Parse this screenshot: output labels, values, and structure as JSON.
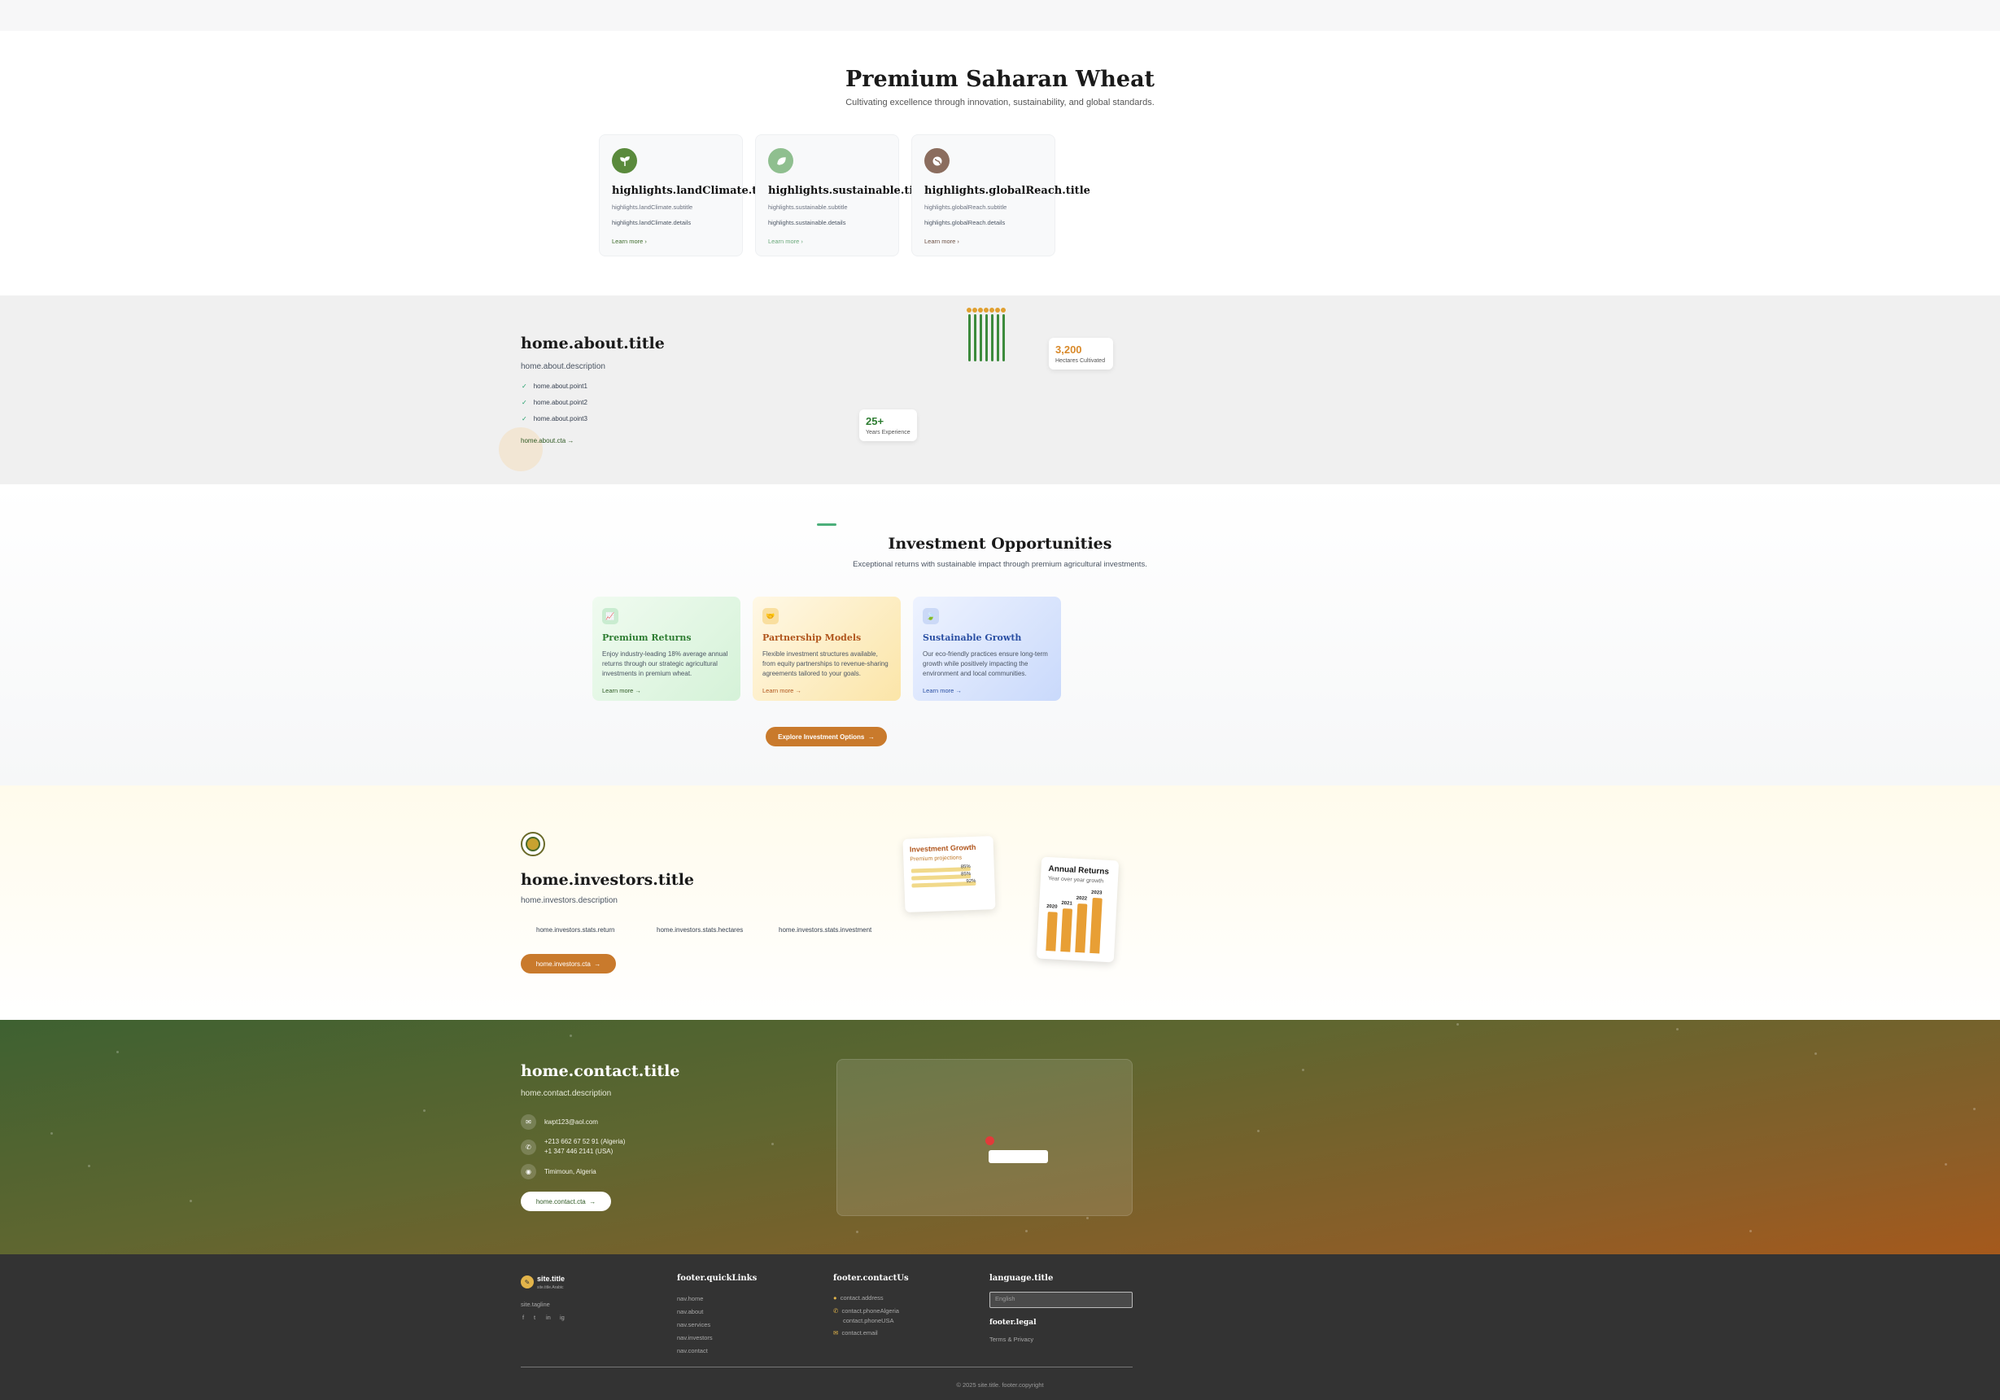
{
  "highlights": {
    "title": "Premium Saharan Wheat",
    "subtitle": "Cultivating excellence through innovation, sustainability, and global standards.",
    "cards": [
      {
        "icon": "sprout-icon",
        "color": "#5a8a3c",
        "title": "highlights.landClimate.title",
        "subtitle": "highlights.landClimate.subtitle",
        "details": "highlights.landClimate.details",
        "link": "Learn more ›",
        "link_color": "#3d6b2a"
      },
      {
        "icon": "leaf-icon",
        "color": "#8fbf8f",
        "title": "highlights.sustainable.title",
        "subtitle": "highlights.sustainable.subtitle",
        "details": "highlights.sustainable.details",
        "link": "Learn more ›",
        "link_color": "#6aa97a"
      },
      {
        "icon": "globe-icon",
        "color": "#8b6d5e",
        "title": "highlights.globalReach.title",
        "subtitle": "highlights.globalReach.subtitle",
        "details": "highlights.globalReach.details",
        "link": "Learn more ›",
        "link_color": "#6b4f43"
      }
    ]
  },
  "about": {
    "title": "home.about.title",
    "description": "home.about.description",
    "points": [
      "home.about.point1",
      "home.about.point2",
      "home.about.point3"
    ],
    "cta": "home.about.cta",
    "stats": [
      {
        "value": "3,200",
        "label": "Hectares Cultivated",
        "color": "#d98a2b"
      },
      {
        "value": "25+",
        "label": "Years Experience",
        "color": "#2e7d32"
      }
    ]
  },
  "investment": {
    "title": "Investment Opportunities",
    "subtitle": "Exceptional returns with sustainable impact through premium agricultural investments.",
    "cards": [
      {
        "icon": "chart-icon",
        "title": "Premium Returns",
        "description": "Enjoy industry-leading 18% average annual returns through our strategic agricultural investments in premium wheat.",
        "link": "Learn more →",
        "title_color": "#2e7d32",
        "link_color": "#2e5a24",
        "bg": "linear-gradient(135deg,#f0fbf0,#d5f2d8)",
        "icon_bg": "#c9ecd0",
        "icon_color": "#2e7d32"
      },
      {
        "icon": "handshake-icon",
        "title": "Partnership Models",
        "description": "Flexible investment structures available, from equity partnerships to revenue-sharing agreements tailored to your goals.",
        "link": "Learn more →",
        "title_color": "#b0551c",
        "link_color": "#b0551c",
        "bg": "linear-gradient(135deg,#fff8e6,#fbe5a8)",
        "icon_bg": "#f9df9f",
        "icon_color": "#b0551c"
      },
      {
        "icon": "leaf-icon",
        "title": "Sustainable Growth",
        "description": "Our eco-friendly practices ensure long-term growth while positively impacting the environment and local communities.",
        "link": "Learn more →",
        "title_color": "#2a4fa3",
        "link_color": "#2a4fa3",
        "bg": "linear-gradient(135deg,#eef3ff,#c9d9fb)",
        "icon_bg": "#cbd9f7",
        "icon_color": "#2a4fa3"
      }
    ],
    "button": "Explore Investment Options"
  },
  "investors": {
    "title": "home.investors.title",
    "description": "home.investors.description",
    "stats": [
      "home.investors.stats.return",
      "home.investors.stats.hectares",
      "home.investors.stats.investment"
    ],
    "cta": "home.investors.cta",
    "growth_card": {
      "title": "Investment Growth",
      "subtitle": "Premium projections",
      "bars": [
        {
          "label": "85%",
          "value": 85
        },
        {
          "label": "85%",
          "value": 85
        },
        {
          "label": "92%",
          "value": 92
        }
      ]
    },
    "returns_card": {
      "title": "Annual Returns",
      "subtitle": "Year over year growth",
      "chart_data": {
        "type": "bar",
        "categories": [
          "2020",
          "2021",
          "2022",
          "2023"
        ],
        "values": [
          60,
          66,
          75,
          85
        ],
        "title": "Annual Returns",
        "subtitle": "Year over year growth"
      }
    }
  },
  "contact": {
    "title": "home.contact.title",
    "description": "home.contact.description",
    "email": "kwpt123@aol.com",
    "phone1": "+213 662 67 52 91 (Algeria)",
    "phone2": "+1 347 446 2141 (USA)",
    "address": "Timimoun, Algeria",
    "cta": "home.contact.cta"
  },
  "footer": {
    "site_title": "site.title",
    "site_title_ar": "site.title.Arabic",
    "tagline": "site.tagline",
    "social": [
      "f",
      "t",
      "in",
      "ig"
    ],
    "quicklinks_title": "footer.quickLinks",
    "quicklinks": [
      "nav.home",
      "nav.about",
      "nav.services",
      "nav.investors",
      "nav.contact"
    ],
    "contact_title": "footer.contactUs",
    "contact_address": "contact.address",
    "contact_phone1": "contact.phoneAlgeria",
    "contact_phone2": "contact.phoneUSA",
    "contact_email": "contact.email",
    "language_title": "language.title",
    "language_value": "English",
    "legal_title": "footer.legal",
    "legal_link": "Terms & Privacy",
    "copyright": "© 2025 site.title. footer.copyright"
  }
}
